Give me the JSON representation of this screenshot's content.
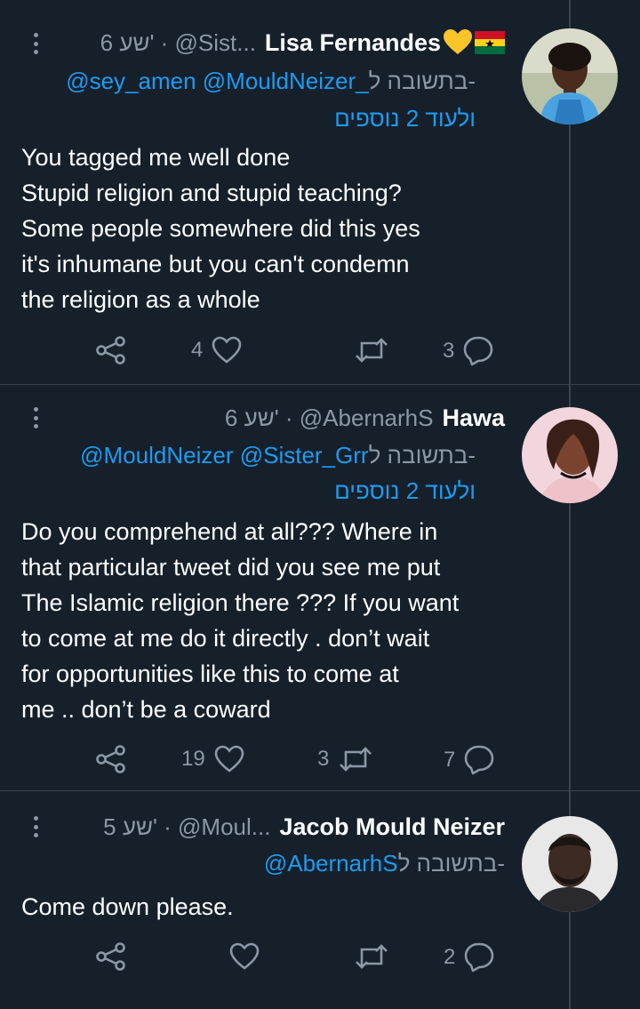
{
  "tweets": [
    {
      "meta": "6 שע' · @Sist...",
      "name": "Lisa Fernandes",
      "reply_prefix": "בתשובה ל-",
      "reply_links": "@sey_amen @MouldNeizer_",
      "reply_more": "ולעוד 2 נוספים",
      "body": "You tagged me well done\nStupid religion and stupid teaching?\nSome people somewhere did this yes\nit's inhumane but you can't condemn\nthe religion as a whole",
      "likes": "4",
      "retweets": "",
      "replies": "3"
    },
    {
      "meta": "6 שע' · @AbernarhS",
      "name": "Hawa",
      "reply_prefix": "בתשובה ל-",
      "reply_links": "@MouldNeizer @Sister_Grr",
      "reply_more": "ולעוד 2 נוספים",
      "body": "Do you comprehend at all??? Where in\nthat particular tweet did you see me put\nThe Islamic religion there ??? If you want\nto come at me do it directly . don’t wait\nfor opportunities like this to come at\nme .. don’t be a coward",
      "likes": "19",
      "retweets": "3",
      "replies": "7"
    },
    {
      "meta": "5 שע' · @Moul...",
      "name": "Jacob Mould Neizer",
      "reply_prefix": "בתשובה ל-",
      "reply_links": "@AbernarhS",
      "reply_more": "",
      "body": "Come down please.",
      "likes": "",
      "retweets": "",
      "replies": "2"
    }
  ],
  "icons": {
    "share": "share-icon",
    "like": "heart-icon",
    "retweet": "retweet-icon",
    "reply": "reply-bubble-icon",
    "more": "more-vertical-icon",
    "emoji": "yellow-heart-emoji",
    "flag": "ghana-flag-emoji"
  },
  "colors": {
    "background": "#15202b",
    "link": "#1d9bf0",
    "muted": "#8b98a5",
    "divider": "#38444d"
  }
}
